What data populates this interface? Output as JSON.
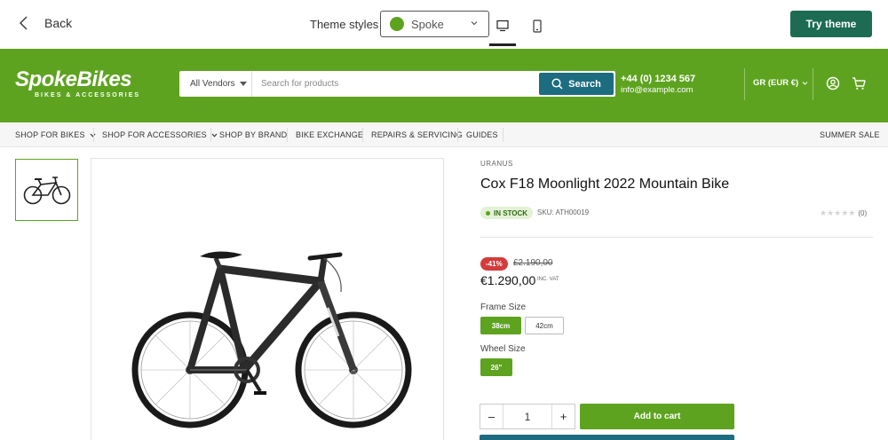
{
  "editor": {
    "back_label": "Back",
    "theme_styles_label": "Theme styles",
    "theme_selected": "Spoke",
    "theme_color": "#5ea320",
    "devices": [
      "desktop-icon",
      "mobile-icon"
    ],
    "try_theme_label": "Try theme"
  },
  "header": {
    "logo_main": "SpokeBikes",
    "logo_sub": "BIKES & ACCESSORIES",
    "vendors_label": "All Vendors",
    "search_placeholder": "Search for products",
    "search_button": "Search",
    "phone": "+44 (0) 1234 567",
    "email": "info@example.com",
    "currency": "GR (EUR €)",
    "brand_color": "#5ea320",
    "accent_color": "#1d6c80"
  },
  "nav": {
    "items": [
      {
        "label": "SHOP FOR BIKES",
        "dropdown": true
      },
      {
        "label": "SHOP FOR ACCESSORIES",
        "dropdown": true
      },
      {
        "label": "SHOP BY BRAND",
        "dropdown": false
      },
      {
        "label": "BIKE EXCHANGE",
        "dropdown": false
      },
      {
        "label": "REPAIRS & SERVICING",
        "dropdown": false
      },
      {
        "label": "GUIDES",
        "dropdown": false
      }
    ],
    "right_item": "SUMMER SALE"
  },
  "product": {
    "vendor": "URANUS",
    "title": "Cox F18 Moonlight 2022 Mountain Bike",
    "stock": "IN STOCK",
    "sku": "SKU: ATH00019",
    "rating_stars": 0,
    "rating_count": "(0)",
    "discount": "-41%",
    "old_price": "£2.190,00",
    "price": "€1.290,00",
    "vat_note": "INC. VAT",
    "frame_size_label": "Frame Size",
    "frame_sizes": [
      {
        "label": "38cm",
        "selected": true
      },
      {
        "label": "42cm",
        "selected": false
      }
    ],
    "wheel_size_label": "Wheel Size",
    "wheel_sizes": [
      {
        "label": "26\"",
        "selected": true
      }
    ],
    "quantity": "1",
    "minus": "–",
    "plus": "+",
    "add_to_cart": "Add to cart"
  }
}
